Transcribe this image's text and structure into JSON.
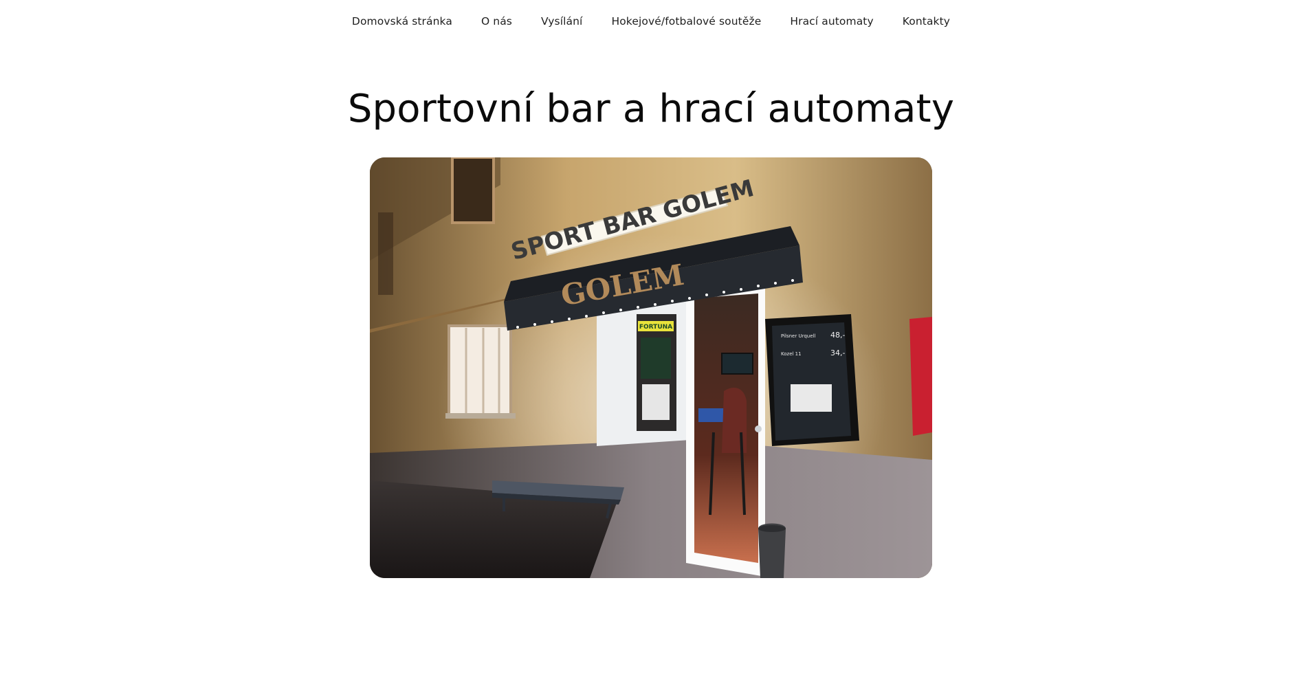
{
  "nav": {
    "items": [
      {
        "label": "Domovská stránka"
      },
      {
        "label": "O nás"
      },
      {
        "label": "Vysílání"
      },
      {
        "label": "Hokejové/fotbalové soutěže"
      },
      {
        "label": "Hrací automaty"
      },
      {
        "label": "Kontakty"
      }
    ]
  },
  "main": {
    "title": "Sportovní bar a hrací automaty"
  },
  "photo": {
    "sign_text": "SPORT BAR GOLEM",
    "awning_text": "GOLEM",
    "door_label": "FORTUNA",
    "menu_lines": [
      {
        "name": "Pilsner Urquell",
        "price": "48,-"
      },
      {
        "name": "Kozel 11",
        "price": "34,-"
      }
    ]
  }
}
